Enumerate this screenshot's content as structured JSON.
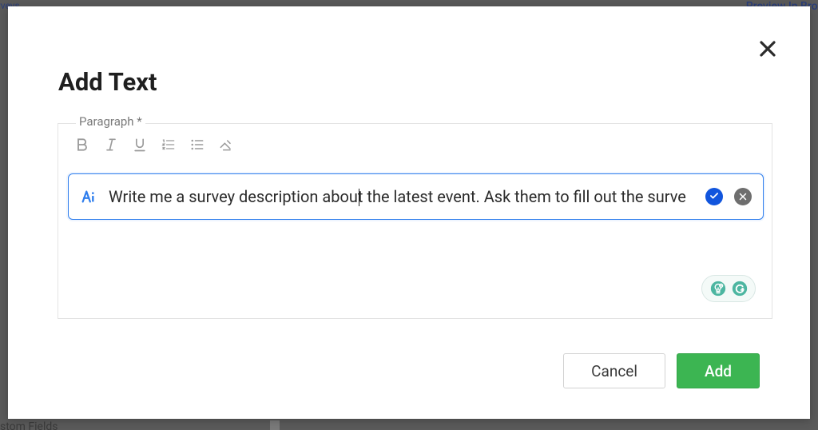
{
  "background": {
    "hint_left": "urveys",
    "hint_right": "Preview In Brow",
    "hint_bottom": "stom Fields"
  },
  "modal": {
    "title": "Add Text",
    "close_label": "Close"
  },
  "editor": {
    "field_label": "Paragraph *",
    "toolbar": {
      "bold": "Bold",
      "italic": "Italic",
      "underline": "Underline",
      "ol": "Numbered list",
      "ul": "Bullet list",
      "clear": "Clear formatting"
    },
    "ai": {
      "icon": "ai",
      "text": "Write me a survey description about the latest event. Ask them to fill out the surve",
      "confirm": "Accept",
      "cancel": "Dismiss"
    },
    "assist": {
      "left": "suggestion",
      "right": "grammar"
    }
  },
  "footer": {
    "cancel": "Cancel",
    "add": "Add"
  }
}
